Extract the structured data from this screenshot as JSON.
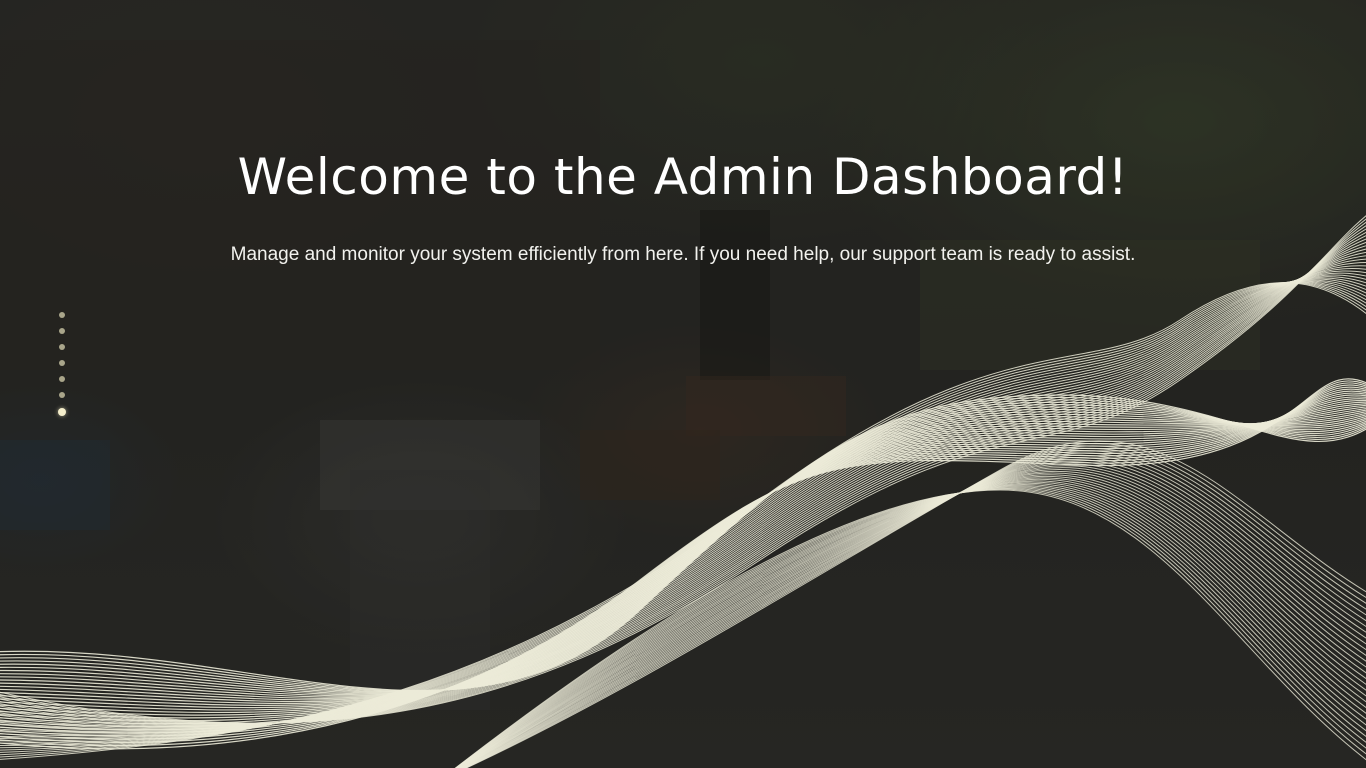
{
  "hero": {
    "title": "Welcome to the Admin Dashboard!",
    "subtitle": "Manage and monitor your system efficiently from here. If you need help, our support team is ready to assist."
  },
  "slider": {
    "dots": [
      {
        "name": "slide-dot-1",
        "active": false
      },
      {
        "name": "slide-dot-2",
        "active": false
      },
      {
        "name": "slide-dot-3",
        "active": false
      },
      {
        "name": "slide-dot-4",
        "active": false
      },
      {
        "name": "slide-dot-5",
        "active": false
      },
      {
        "name": "slide-dot-6",
        "active": false
      },
      {
        "name": "slide-dot-7",
        "active": true
      }
    ]
  },
  "colors": {
    "wave_line": "#ecebd8",
    "dot_inactive": "#a9a58a",
    "dot_active": "#f4eecb",
    "text": "#ffffff"
  }
}
